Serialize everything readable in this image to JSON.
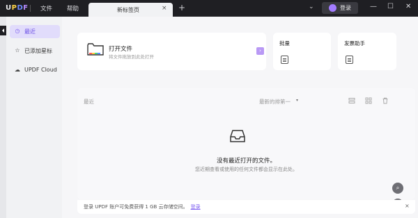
{
  "titlebar": {
    "logo": {
      "u": "U",
      "p": "P",
      "d": "D",
      "f": "F"
    },
    "menus": [
      "文件",
      "帮助"
    ],
    "tab_title": "新标签页",
    "tab_close": "×",
    "new_tab": "+",
    "chevron": "⌄",
    "login_label": "登录",
    "window_controls": {
      "minimize": "—",
      "maximize": "☐",
      "close": "✕"
    }
  },
  "sidebar": {
    "items": [
      {
        "label": "最近",
        "icon": "clock-icon",
        "glyph": "◷",
        "active": true
      },
      {
        "label": "已添加星标",
        "icon": "star-icon",
        "glyph": "☆",
        "active": false
      },
      {
        "label": "UPDF Cloud",
        "icon": "cloud-icon",
        "glyph": "☁",
        "active": false
      }
    ]
  },
  "open_card": {
    "title": "打开文件",
    "subtitle": "将文件拖放到此处打开",
    "arrow": "›"
  },
  "batch_card": {
    "title": "批量"
  },
  "assistant_card": {
    "title": "发票助手"
  },
  "recent": {
    "label": "最近",
    "sort_label": "最新的排第一",
    "sort_caret": "▾",
    "empty_title": "没有最近打开的文件。",
    "empty_subtitle": "您近期查看或使用的任何文件都会显示在此处。"
  },
  "bottom_bar": {
    "text": "登录 UPDF 账户可免费获得 1 GB 云存储空间。",
    "link": "登录",
    "close": "×"
  },
  "fabs": {
    "search": "⌕",
    "help": "?"
  },
  "colors": {
    "accent": "#7c5cf0",
    "titlebar": "#1f1f23",
    "active_bg": "#e1dcfb"
  }
}
